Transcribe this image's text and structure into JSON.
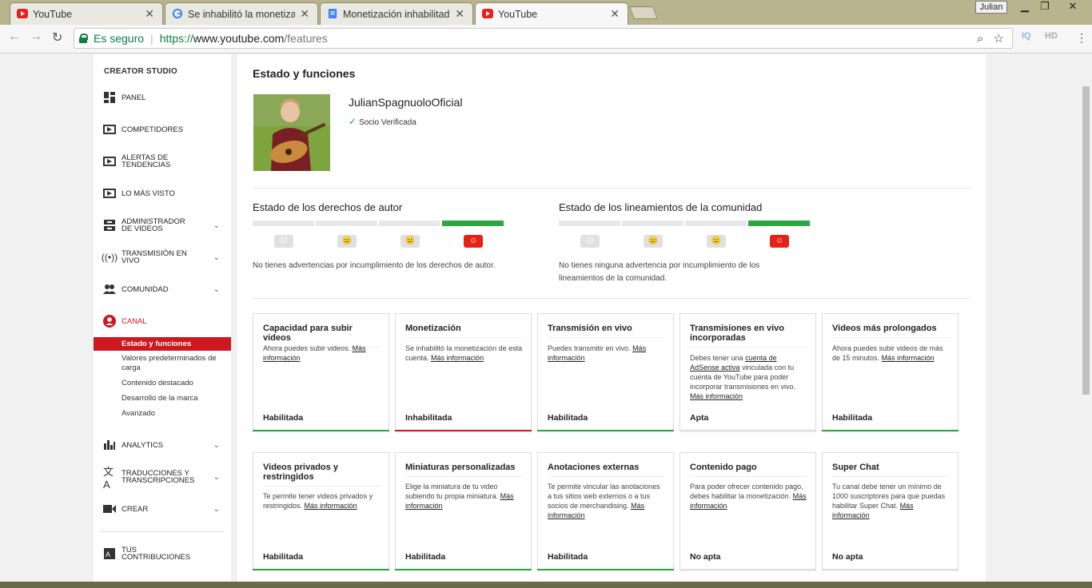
{
  "browser": {
    "tabs": [
      {
        "title": "YouTube",
        "icon": "youtube-icon"
      },
      {
        "title": "Se inhabilitó la monetiza",
        "icon": "google-icon"
      },
      {
        "title": "Monetización inhabilitad",
        "icon": "docs-icon"
      },
      {
        "title": "YouTube",
        "icon": "youtube-icon"
      }
    ],
    "user_label": "Julian",
    "secure_label": "Es seguro",
    "url_proto": "https://",
    "url_host": "www.youtube.com",
    "url_path": "/features",
    "ext_label": "HD"
  },
  "sidebar": {
    "title": "CREATOR STUDIO",
    "items": [
      {
        "label": "PANEL"
      },
      {
        "label": "COMPETIDORES"
      },
      {
        "label": "ALERTAS DE TENDENCIAS"
      },
      {
        "label": "LO MÁS VISTO"
      },
      {
        "label": "ADMINISTRADOR DE VIDEOS"
      },
      {
        "label": "TRANSMISIÓN EN VIVO"
      },
      {
        "label": "COMUNIDAD"
      },
      {
        "label": "CANAL"
      },
      {
        "label": "ANALYTICS"
      },
      {
        "label": "TRADUCCIONES Y TRANSCRIPCIONES"
      },
      {
        "label": "CREAR"
      },
      {
        "label": "TUS CONTRIBUCIONES"
      }
    ],
    "channel_sub": [
      {
        "label": "Estado y funciones"
      },
      {
        "label": "Valores predeterminados de carga"
      },
      {
        "label": "Contenido destacado"
      },
      {
        "label": "Desarrollo de la marca"
      },
      {
        "label": "Avanzado"
      }
    ]
  },
  "main": {
    "title": "Estado y funciones",
    "channel_name": "JulianSpagnuoloOficial",
    "verified_label": "Socio Verificada",
    "copyright": {
      "title": "Estado de los derechos de autor",
      "desc": "No tienes advertencias por incumplimiento de los derechos de autor."
    },
    "community": {
      "title": "Estado de los lineamientos de la comunidad",
      "desc_1": "No tienes ninguna advertencia por incumplimiento de los",
      "desc_2": "lineamientos de la comunidad."
    },
    "cards": [
      {
        "title": "Capacidad para subir videos",
        "desc": "Ahora puedes subir videos.",
        "link": "Más información",
        "status": "Habilitada",
        "color": "#2ba640"
      },
      {
        "title": "Monetización",
        "desc": "Se inhabilitó la monetización de esta cuenta.",
        "link": "Más información",
        "status": "Inhabilitada",
        "color": "#cc181e"
      },
      {
        "title": "Transmisión en vivo",
        "desc": "Puedes transmitir en vivo.",
        "link": "Más información",
        "status": "Habilitada",
        "color": "#2ba640"
      },
      {
        "title": "Transmisiones en vivo incorporadas",
        "desc_pre": "Debes tener una",
        "adsense": "cuenta de AdSense activa",
        "desc": "vinculada con tu cuenta de YouTube para poder incorporar transmisiones en vivo.",
        "link": "Más información",
        "status": "Apta",
        "color": "#dddddd"
      },
      {
        "title": "Videos más prolongados",
        "desc": "Ahora puedes subir videos de más de 15 minutos.",
        "link": "Más información",
        "status": "Habilitada",
        "color": "#2ba640"
      },
      {
        "title": "Videos privados y restringidos",
        "desc": "Te permite tener videos privados y restringidos.",
        "link": "Más información",
        "status": "Habilitada",
        "color": "#2ba640"
      },
      {
        "title": "Miniaturas personalizadas",
        "desc": "Elige la miniatura de tu video subiendo tu propia miniatura.",
        "link": "Más información",
        "status": "Habilitada",
        "color": "#2ba640"
      },
      {
        "title": "Anotaciones externas",
        "desc": "Te permite vincular las anotaciones a tus sitios web externos o a tus socios de merchandising.",
        "link": "Más información",
        "status": "Habilitada",
        "color": "#2ba640"
      },
      {
        "title": "Contenido pago",
        "desc": "Para poder ofrecer contenido pago, debes habilitar la monetización.",
        "link": "Más información",
        "status": "No apta",
        "color": "#dddddd"
      },
      {
        "title": "Super Chat",
        "desc": "Tu canal debe tener un mínimo de 1000 suscriptores para que puedas habilitar Super Chat.",
        "link": "Más información",
        "status": "No apta",
        "color": "#dddddd"
      }
    ]
  }
}
